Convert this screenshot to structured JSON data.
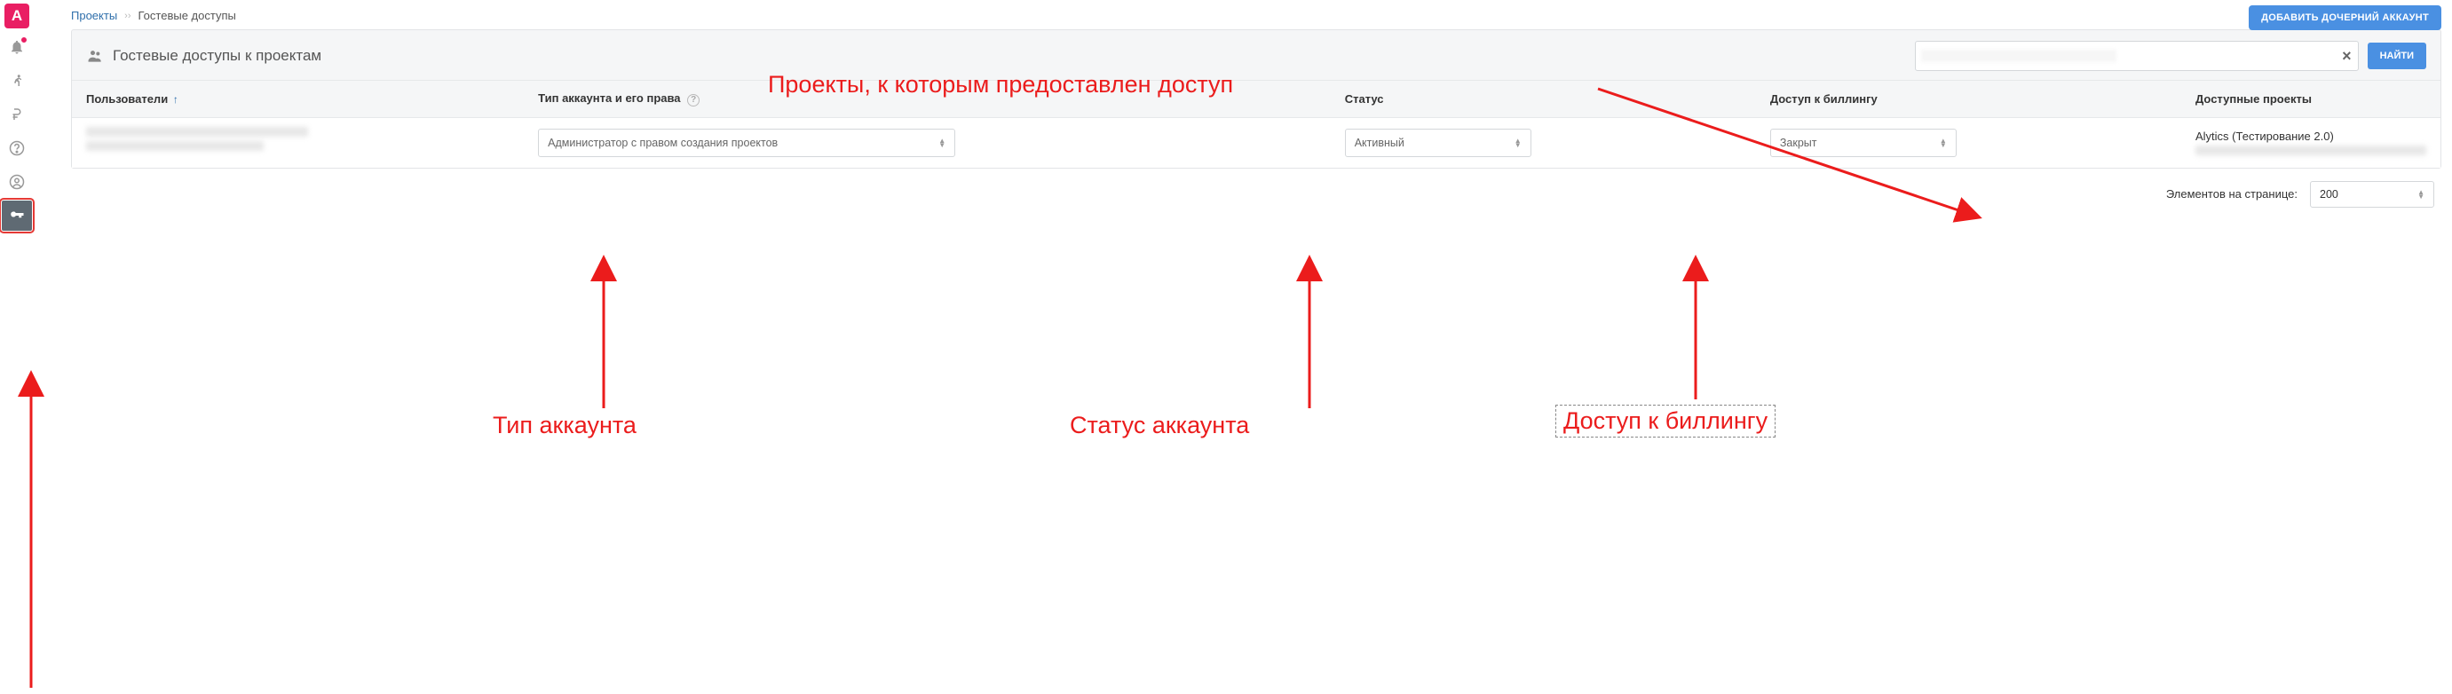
{
  "sidebar": {
    "logo": "A",
    "items": [
      {
        "name": "bell-icon"
      },
      {
        "name": "running-man-icon"
      },
      {
        "name": "ruble-icon"
      },
      {
        "name": "question-icon"
      },
      {
        "name": "user-circle-icon"
      },
      {
        "name": "key-icon",
        "active": true
      }
    ]
  },
  "breadcrumb": {
    "root": "Проекты",
    "current": "Гостевые доступы"
  },
  "buttons": {
    "add_child": "ДОБАВИТЬ ДОЧЕРНИЙ АККАУНТ",
    "find": "НАЙТИ"
  },
  "panel": {
    "title": "Гостевые доступы к проектам"
  },
  "table": {
    "columns": {
      "users": "Пользователи",
      "account_type": "Тип аккаунта и его права",
      "status": "Статус",
      "billing": "Доступ к биллингу",
      "projects": "Доступные проекты"
    },
    "rows": [
      {
        "account_type_value": "Администратор с правом создания проектов",
        "status_value": "Активный",
        "billing_value": "Закрыт",
        "project_visible": "Alytics (Тестирование 2.0)"
      }
    ]
  },
  "pager": {
    "label": "Элементов на странице:",
    "value": "200"
  },
  "annotations": {
    "top": "Проекты, к которым предоставлен доступ",
    "account_type": "Тип аккаунта",
    "status": "Статус аккаунта",
    "billing": "Доступ к биллингу"
  }
}
